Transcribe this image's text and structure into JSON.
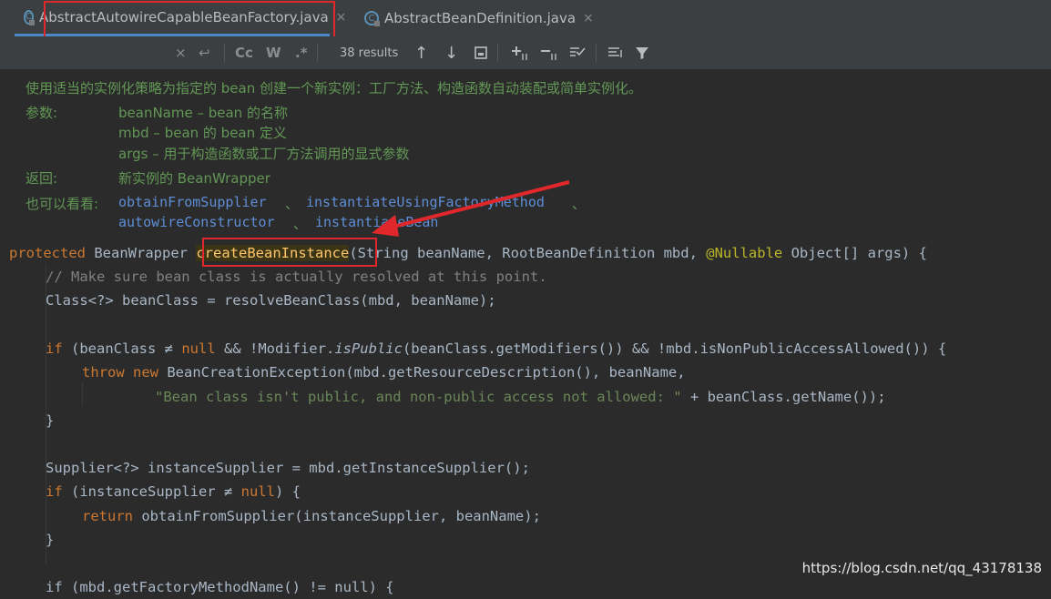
{
  "tabs": [
    {
      "label": "AbstractAutowireCapableBeanFactory.java",
      "active": true,
      "icon": "class-icon",
      "close": "×"
    },
    {
      "label": "AbstractBeanDefinition.java",
      "active": false,
      "icon": "class-icon",
      "close": "×"
    }
  ],
  "findbar": {
    "close": "×",
    "replace_icon": "↩",
    "match_case": "Cc",
    "whole_word": "W",
    "regex": ".*",
    "results": "38 results",
    "prev": "↑",
    "next": "↓"
  },
  "doc": {
    "summary": "使用适当的实例化策略为指定的 bean 创建一个新实例：工厂方法、构造函数自动装配或简单实例化。",
    "params_label": "参数:",
    "params": [
      "beanName – bean 的名称",
      "mbd – bean 的 bean 定义",
      "args – 用于构造函数或工厂方法调用的显式参数"
    ],
    "returns_label": "返回:",
    "returns": "新实例的 BeanWrapper",
    "see_label": "也可以看看:",
    "see": [
      "obtainFromSupplier",
      "instantiateUsingFactoryMethod",
      "autowireConstructor",
      "instantiateBean"
    ],
    "see_sep": "、"
  },
  "code": {
    "sig_kw": "protected",
    "sig_type": "BeanWrapper",
    "sig_method": "createBeanInstance",
    "sig_params_1": "(String beanName, RootBeanDefinition mbd, ",
    "sig_ann": "@Nullable",
    "sig_params_2": " Object[] args) {",
    "comment": "// Make sure bean class is actually resolved at this point.",
    "l2": "Class<?> beanClass = resolveBeanClass(mbd, beanName);",
    "if1_kw": "if",
    "if1_a": " (beanClass ≠ ",
    "null": "null",
    "if1_b": " && !Modifier.",
    "isPublic": "isPublic",
    "if1_c": "(beanClass.getModifiers()) && !mbd.isNonPublicAccessAllowed()) {",
    "throw": "throw",
    "new": "new",
    "throw_rest": " BeanCreationException(mbd.getResourceDescription(), beanName,",
    "str": "\"Bean class isn't public, and non-public access not allowed: \"",
    "str_rest": " + beanClass.getName());",
    "close": "}",
    "supplier": "Supplier<?> instanceSupplier = mbd.getInstanceSupplier();",
    "if2_a": " (instanceSupplier ≠ ",
    "if2_b": ") {",
    "return": "return",
    "return_rest": " obtainFromSupplier(instanceSupplier, beanName);",
    "last": "if (mbd.getFactoryMethodName() != null) {"
  },
  "watermark": "https://blog.csdn.net/qq_43178138",
  "colors": {
    "keyword": "#cc7832",
    "method": "#ffc66d",
    "doc": "#629755",
    "link": "#5e8ed6",
    "highlight": "#e0282c"
  }
}
